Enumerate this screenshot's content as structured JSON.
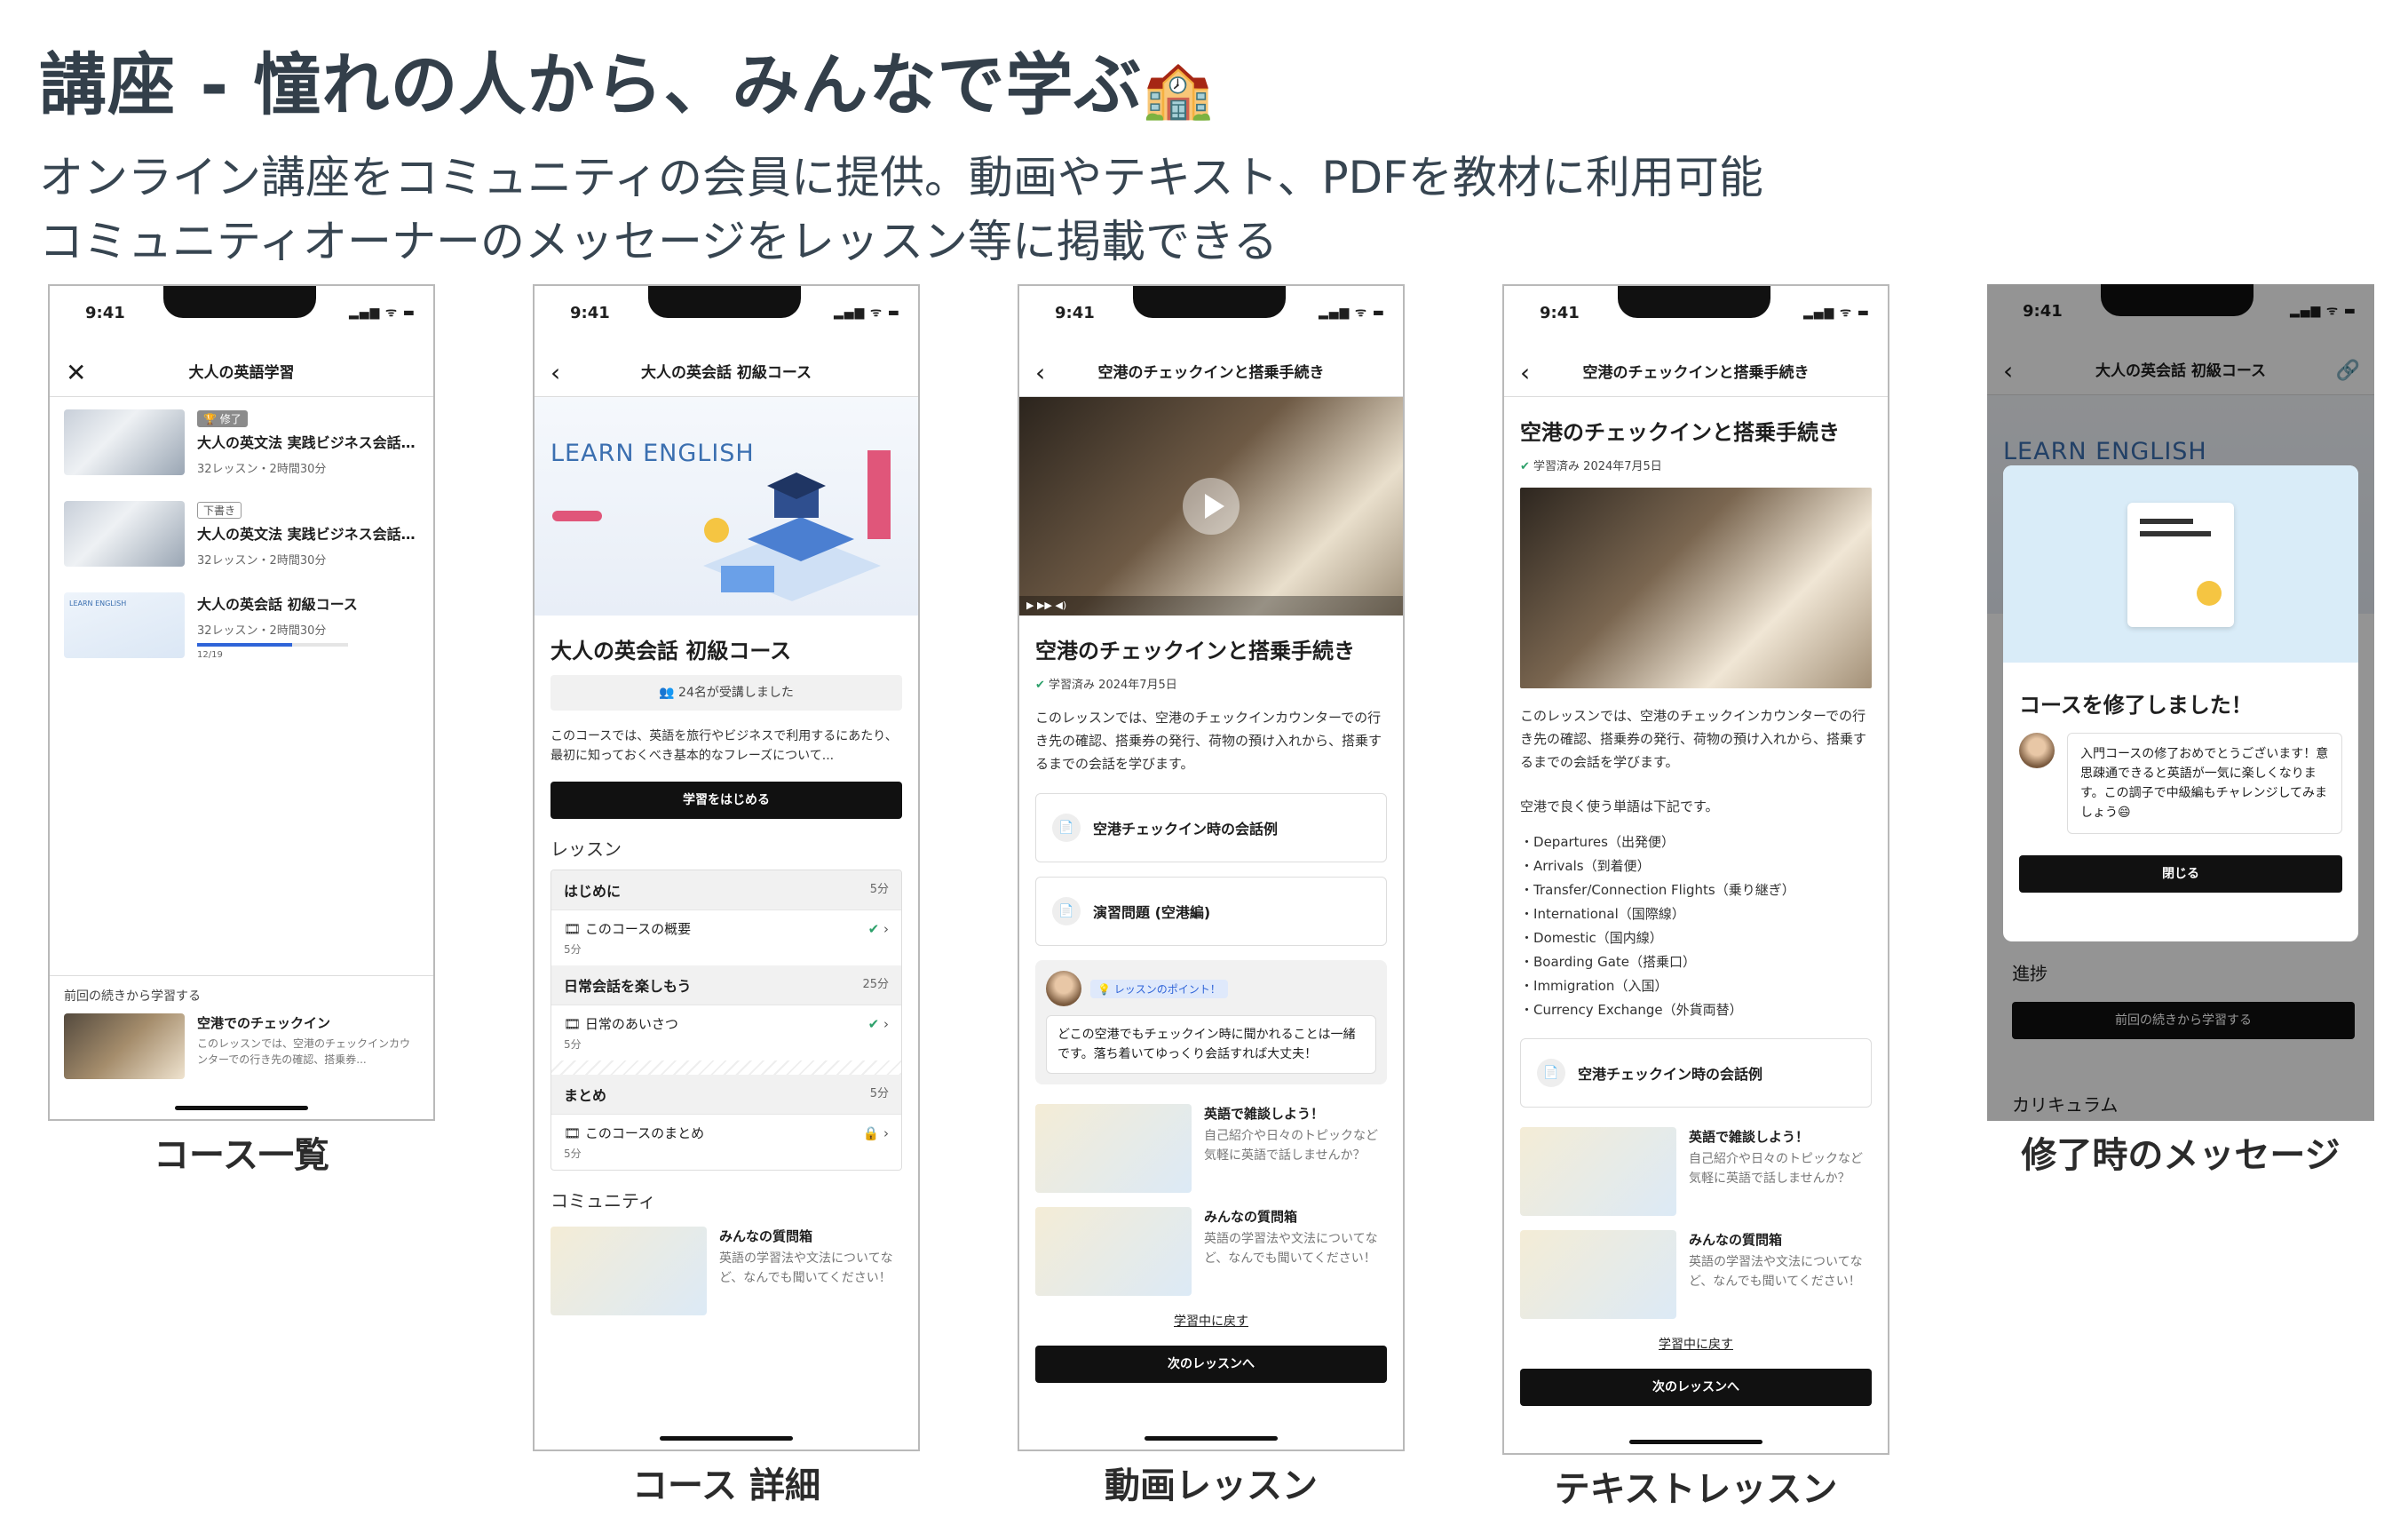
{
  "header": {
    "title": "講座 - 憧れの人から、みんなで学ぶ",
    "title_emoji": "🏫",
    "subtitle_line1": "オンライン講座をコミュニティの会員に提供。動画やテキスト、PDFを教材に利用可能",
    "subtitle_line2": "コミュニティオーナーのメッセージをレッスン等に掲載できる"
  },
  "status_bar": {
    "time": "9:41",
    "signal": "▂▄▆ ᯤ ▬"
  },
  "screens": {
    "list": {
      "caption": "コース一覧",
      "nav_title": "大人の英語学習",
      "close_icon": "✕",
      "courses": [
        {
          "tag": "🏆 修了",
          "title": "大人の英文法 実践ビジネス会話...",
          "meta": "32レッスン・2時間30分"
        },
        {
          "tag": "下書き",
          "title": "大人の英文法 実践ビジネス会話...",
          "meta": "32レッスン・2時間30分"
        },
        {
          "title": "大人の英会話 初級コース",
          "meta": "32レッスン・2時間30分",
          "progress": 0.63,
          "progress_text": "12/19"
        }
      ],
      "continue_label": "前回の続きから学習する",
      "continue_title": "空港でのチェックイン",
      "continue_desc": "このレッスンでは、空港のチェックインカウンターでの行き先の確認、搭乗券...",
      "thumb_learn_text": "LEARN ENGLISH"
    },
    "detail": {
      "caption": "コース 詳細",
      "nav_title": "大人の英会話 初級コース",
      "banner_text": "LEARN ENGLISH",
      "course_title": "大人の英会話 初級コース",
      "enrolled": "24名が受講しました",
      "description": "このコースでは、英語を旅行やビジネスで利用するにあたり、最初に知っておくべき基本的なフレーズについて...",
      "start_button": "学習をはじめる",
      "lessons_label": "レッスン",
      "sections": [
        {
          "title": "はじめに",
          "dur": "5分",
          "row": "このコースの概要",
          "row_dur": "5分"
        },
        {
          "title": "日常会話を楽しもう",
          "dur": "25分",
          "row": "日常のあいさつ",
          "row_dur": "5分"
        },
        {
          "title": "まとめ",
          "dur": "5分",
          "row": "このコースのまとめ",
          "row_dur": "5分"
        }
      ],
      "community_label": "コミュニティ",
      "community_title": "みんなの質問箱",
      "community_desc": "英語の学習法や文法についてなど、なんでも聞いてください！"
    },
    "video": {
      "caption": "動画レッスン",
      "nav_title": "空港のチェックインと搭乗手続き",
      "lesson_title": "空港のチェックインと搭乗手続き",
      "learned": "学習済み 2024年7月5日",
      "description": "このレッスンでは、空港のチェックインカウンターでの行き先の確認、搭乗券の発行、荷物の預け入れから、搭乗するまでの会話を学びます。",
      "attachments": [
        "空港チェックイン時の会話例",
        "演習問題 (空港編)"
      ],
      "point_tag": "💡 レッスンのポイント！",
      "point_text": "どこの空港でもチェックイン時に聞かれることは一緒です。落ち着いてゆっくり会話すれば大丈夫！",
      "community": [
        {
          "title": "英語で雑談しよう！",
          "desc": "自己紹介や日々のトピックなど気軽に英語で話しませんか？"
        },
        {
          "title": "みんなの質問箱",
          "desc": "英語の学習法や文法についてなど、なんでも聞いてください！"
        }
      ],
      "back_link": "学習中に戻す",
      "next_button": "次のレッスンへ"
    },
    "text": {
      "caption": "テキストレッスン",
      "nav_title": "空港のチェックインと搭乗手続き",
      "lesson_title": "空港のチェックインと搭乗手続き",
      "learned": "学習済み 2024年7月5日",
      "description": "このレッスンでは、空港のチェックインカウンターでの行き先の確認、搭乗券の発行、荷物の預け入れから、搭乗するまでの会話を学びます。",
      "intro": "空港で良く使う単語は下記です。",
      "words": [
        "Departures（出発便）",
        "Arrivals（到着便）",
        "Transfer/Connection Flights（乗り継ぎ）",
        "International（国際線）",
        "Domestic（国内線）",
        "Boarding Gate（搭乗口）",
        "Immigration（入国）",
        "Currency Exchange（外貨両替）"
      ],
      "attachment": "空港チェックイン時の会話例",
      "community": [
        {
          "title": "英語で雑談しよう！",
          "desc": "自己紹介や日々のトピックなど気軽に英語で話しませんか？"
        },
        {
          "title": "みんなの質問箱",
          "desc": "英語の学習法や文法についてなど、なんでも聞いてください！"
        }
      ],
      "back_link": "学習中に戻す",
      "next_button": "次のレッスンへ"
    },
    "complete": {
      "caption": "修了時のメッセージ",
      "nav_title": "大人の英会話 初級コース",
      "banner_text": "LEARN ENGLISH",
      "modal_title": "コースを修了しました！",
      "modal_message": "入門コースの修了おめでとうございます！意思疎通できると英語が一気に楽しくなります。この調子で中級編もチャレンジしてみましょう😄",
      "close_button": "閉じる",
      "bg_progress_label": "進捗",
      "bg_continue": "前回の続きから学習する",
      "bg_curriculum": "カリキュラム"
    }
  },
  "icons": {
    "back": "‹",
    "close": "✕",
    "check": "✔",
    "lock": "🔒",
    "chevron": "›",
    "film": "🎞",
    "file": "📄",
    "link": "🔗"
  }
}
